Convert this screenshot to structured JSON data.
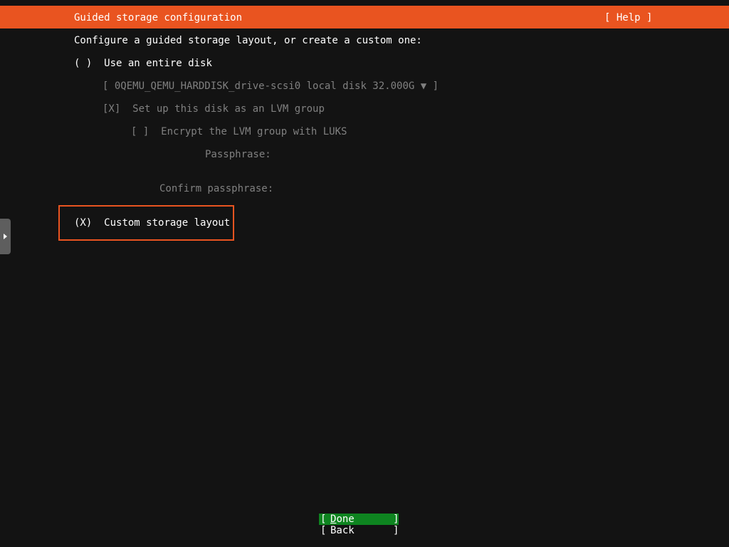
{
  "header": {
    "title": "Guided storage configuration",
    "help_label": "[ Help ]"
  },
  "intro": "Configure a guided storage layout, or create a custom one:",
  "entire_disk": {
    "radio_mark": "( )",
    "label": "Use an entire disk",
    "disk_select": {
      "open_bracket": "[",
      "value": "0QEMU_QEMU_HARDDISK_drive-scsi0 local disk 32.000G",
      "arrow": "▼",
      "close_bracket": "]"
    },
    "lvm": {
      "check_mark": "[X]",
      "label": "Set up this disk as an LVM group"
    },
    "luks": {
      "check_mark": "[ ]",
      "label": "Encrypt the LVM group with LUKS"
    },
    "passphrase_label": "Passphrase:",
    "confirm_passphrase_label": "Confirm passphrase:"
  },
  "custom_layout": {
    "radio_mark": "(X)",
    "label": "Custom storage layout"
  },
  "buttons": {
    "left_bracket": "[",
    "right_bracket": "]",
    "done_first_letter": "D",
    "done_rest": "one",
    "back_label": "Back"
  },
  "colors": {
    "accent": "#e95420",
    "background": "#131313",
    "done_button": "#0e8420",
    "disabled_text": "#808080",
    "side_tab": "#5e5e5e"
  },
  "icons": {
    "side_tab": "chevron-right-icon",
    "dropdown": "triangle-down-icon"
  }
}
